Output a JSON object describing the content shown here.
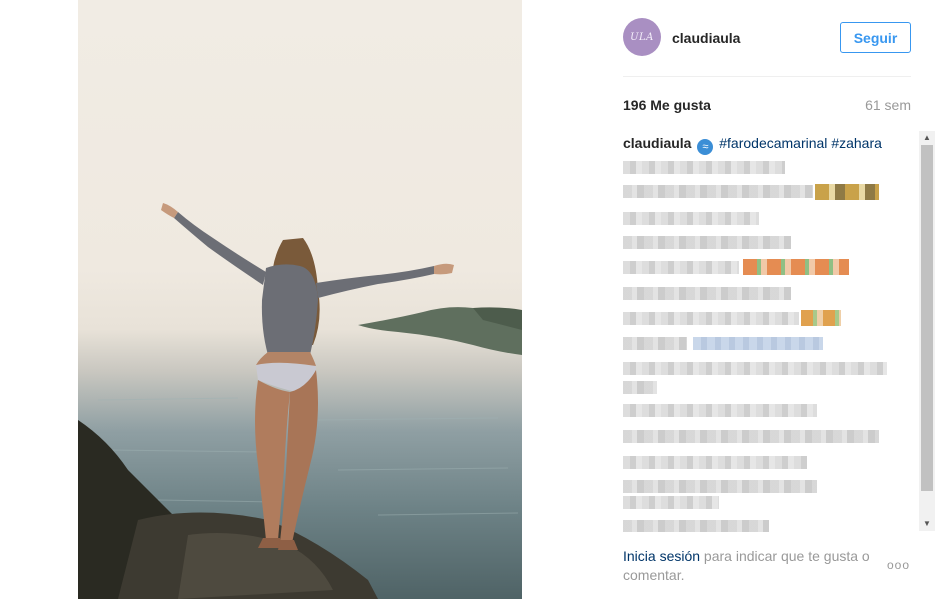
{
  "post": {
    "username": "claudiaula",
    "avatar_text": "ULA",
    "follow_label": "Seguir",
    "likes": "196 Me gusta",
    "age": "61 sem"
  },
  "caption": {
    "username": "claudiaula",
    "emoji": "wave-icon",
    "hashtags": [
      "#farodecamarinal",
      "#zahara"
    ]
  },
  "footer": {
    "login_link": "Inicia sesión",
    "rest": " para indicar que te gusta o comentar.",
    "more_icon": "ellipsis-icon",
    "more_text": "ooo"
  },
  "colors": {
    "accent": "#3897f0",
    "link": "#003569",
    "muted": "#999999",
    "avatar": "#a98fc2"
  },
  "scrollbar": {
    "up_arrow": "▲",
    "down_arrow": "▼"
  }
}
